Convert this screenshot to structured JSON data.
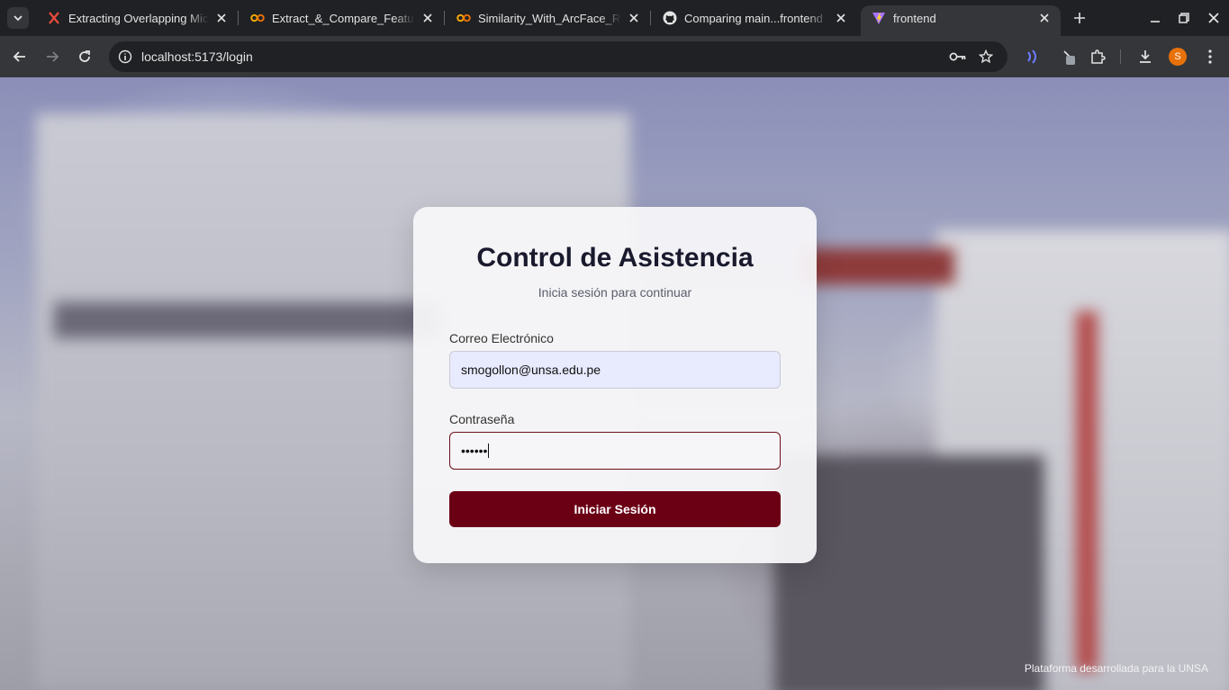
{
  "browser": {
    "tabs": [
      {
        "title": "Extracting Overlapping Micr",
        "icon": "x-logo-icon",
        "active": false
      },
      {
        "title": "Extract_&_Compare_Feature",
        "icon": "colab-icon",
        "active": false
      },
      {
        "title": "Similarity_With_ArcFace_Res",
        "icon": "colab-icon",
        "active": false
      },
      {
        "title": "Comparing main...frontend",
        "icon": "github-icon",
        "active": false
      },
      {
        "title": "frontend",
        "icon": "vite-icon",
        "active": true
      }
    ],
    "url": "localhost:5173/login",
    "profile_initial": "S",
    "colors": {
      "tabstrip": "#202124",
      "toolbar": "#35363a",
      "profile": "#e8710a"
    }
  },
  "login": {
    "title": "Control de Asistencia",
    "subtitle": "Inicia sesión para continuar",
    "email_label": "Correo Electrónico",
    "email_value": "smogollon@unsa.edu.pe",
    "password_label": "Contraseña",
    "password_mask": "••••••",
    "submit_label": "Iniciar Sesión",
    "colors": {
      "accent": "#6b0015",
      "email_bg": "#e8eafd"
    }
  },
  "footer": {
    "text": "Plataforma desarrollada para la UNSA"
  }
}
